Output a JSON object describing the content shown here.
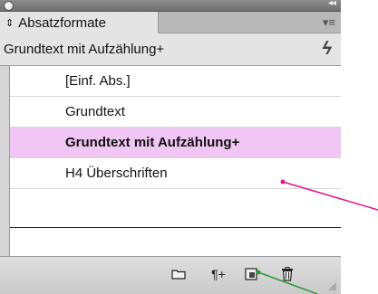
{
  "panel": {
    "tab_label": "Absatzformate",
    "current_style": "Grundtext mit Aufzählung+",
    "tab_sort_icon": "sort-arrows-icon",
    "menu_icon": "panel-menu-icon",
    "override_icon": "lightning-override-icon"
  },
  "list": {
    "items": [
      {
        "label": "[Einf. Abs.]",
        "selected": false
      },
      {
        "label": "Grundtext",
        "selected": false
      },
      {
        "label": "Grundtext mit Aufzählung+",
        "selected": true
      },
      {
        "label": "H4 Überschriften",
        "selected": false
      }
    ],
    "selected_color": "#f0c6f4"
  },
  "footer": {
    "buttons": [
      {
        "name": "new-group-folder-icon"
      },
      {
        "name": "clear-overrides-icon",
        "glyph": "¶+"
      },
      {
        "name": "new-style-icon"
      },
      {
        "name": "delete-style-icon"
      }
    ]
  },
  "annotations": {
    "magenta": "#e0148c",
    "green": "#2a9a3a"
  }
}
